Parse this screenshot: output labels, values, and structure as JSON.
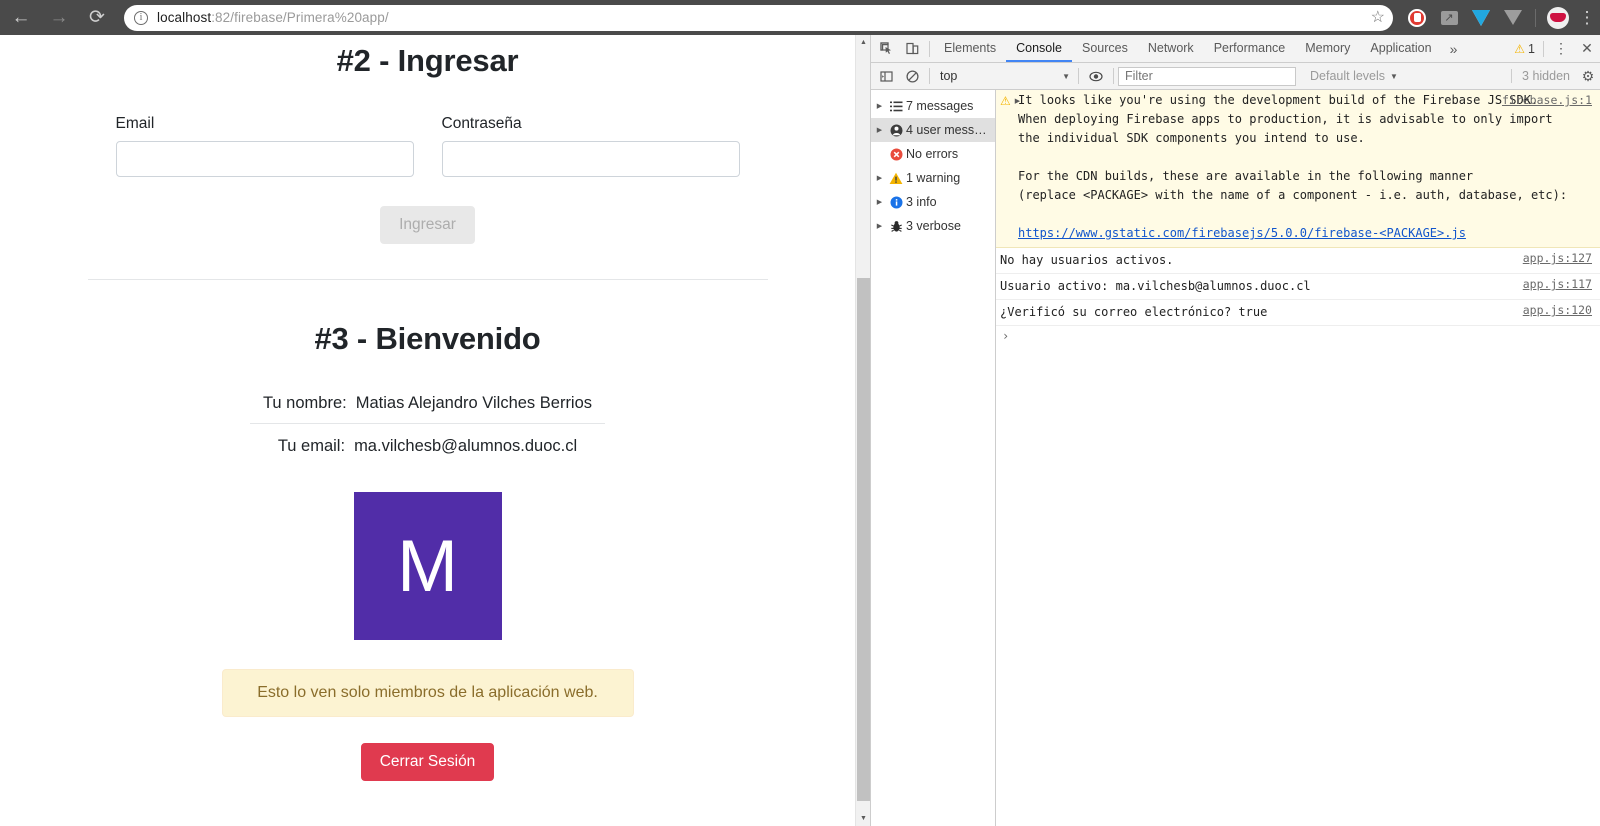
{
  "browser": {
    "back_icon": "←",
    "forward_icon": "→",
    "reload_icon": "⟳",
    "site_info_icon": "i",
    "url_host": "localhost",
    "url_rest": ":82/firebase/Primera%20app/",
    "bookmark_icon": "☆",
    "menu_icon": "⋮",
    "extensions": [
      {
        "name": "adblock-extension-icon"
      },
      {
        "name": "screenshot-extension-icon"
      },
      {
        "name": "grammarly-extension-icon"
      },
      {
        "name": "vee-extension-icon"
      }
    ],
    "profile_avatar": "bulls-avatar"
  },
  "page": {
    "section_ingresar": {
      "title": "#2 - Ingresar",
      "email_label": "Email",
      "email_value": "",
      "password_label": "Contraseña",
      "password_value": "",
      "submit_label": "Ingresar"
    },
    "section_bienvenido": {
      "title": "#3 - Bienvenido",
      "name_label": "Tu nombre:",
      "name_value": "Matias Alejandro Vilches Berrios",
      "email_label": "Tu email:",
      "email_value": "ma.vilchesb@alumnos.duoc.cl",
      "avatar_letter": "M",
      "avatar_color": "#512da8",
      "alert_text": "Esto lo ven solo miembros de la aplicación web.",
      "alert_bg": "#fcf3d2",
      "alert_color": "#8a6d2b",
      "logout_label": "Cerrar Sesión",
      "logout_color": "#e03a4f"
    }
  },
  "devtools": {
    "inspect_icon": "inspect-element-icon",
    "device_icon": "toggle-device-toolbar-icon",
    "tabs": [
      {
        "label": "Elements",
        "active": false
      },
      {
        "label": "Console",
        "active": true
      },
      {
        "label": "Sources",
        "active": false
      },
      {
        "label": "Network",
        "active": false
      },
      {
        "label": "Performance",
        "active": false
      },
      {
        "label": "Memory",
        "active": false
      },
      {
        "label": "Application",
        "active": false
      }
    ],
    "more_tabs_icon": "»",
    "warning_count": "1",
    "kebab_icon": "⋮",
    "close_icon": "✕",
    "filterbar": {
      "sidebar_toggle_icon": "console-sidebar-toggle-icon",
      "clear_icon": "clear-console-icon",
      "context": "top",
      "eye_icon": "live-expression-icon",
      "filter_placeholder": "Filter",
      "levels_label": "Default levels",
      "hidden_label": "3 hidden",
      "settings_icon": "⚙"
    },
    "sidebar": [
      {
        "label": "7 messages",
        "icon": "list-icon",
        "expandable": true,
        "selected": false
      },
      {
        "label": "4 user mess…",
        "icon": "user-icon",
        "expandable": true,
        "selected": true
      },
      {
        "label": "No errors",
        "icon": "error-icon",
        "expandable": false,
        "selected": false
      },
      {
        "label": "1 warning",
        "icon": "warning-icon",
        "expandable": true,
        "selected": false
      },
      {
        "label": "3 info",
        "icon": "info-icon",
        "expandable": true,
        "selected": false
      },
      {
        "label": "3 verbose",
        "icon": "bug-icon",
        "expandable": true,
        "selected": false
      }
    ],
    "messages": [
      {
        "type": "warning",
        "source": "firebase.js:1",
        "body_lines": [
          "It looks like you're using the development build of the Firebase JS SDK.",
          "When deploying Firebase apps to production, it is advisable to only import",
          "the individual SDK components you intend to use.",
          "",
          "For the CDN builds, these are available in the following manner",
          "(replace <PACKAGE> with the name of a component - i.e. auth, database, etc):",
          ""
        ],
        "link": "https://www.gstatic.com/firebasejs/5.0.0/firebase-<PACKAGE>.js"
      },
      {
        "type": "log",
        "text": "No hay usuarios activos.",
        "source": "app.js:127"
      },
      {
        "type": "log",
        "text": "Usuario activo: ma.vilchesb@alumnos.duoc.cl",
        "source": "app.js:117"
      },
      {
        "type": "log",
        "text": "¿Verificó su correo electrónico? true",
        "source": "app.js:120"
      }
    ],
    "prompt_icon": "›"
  },
  "scrollbar": {
    "up_arrow": "▲",
    "down_arrow": "▼"
  }
}
